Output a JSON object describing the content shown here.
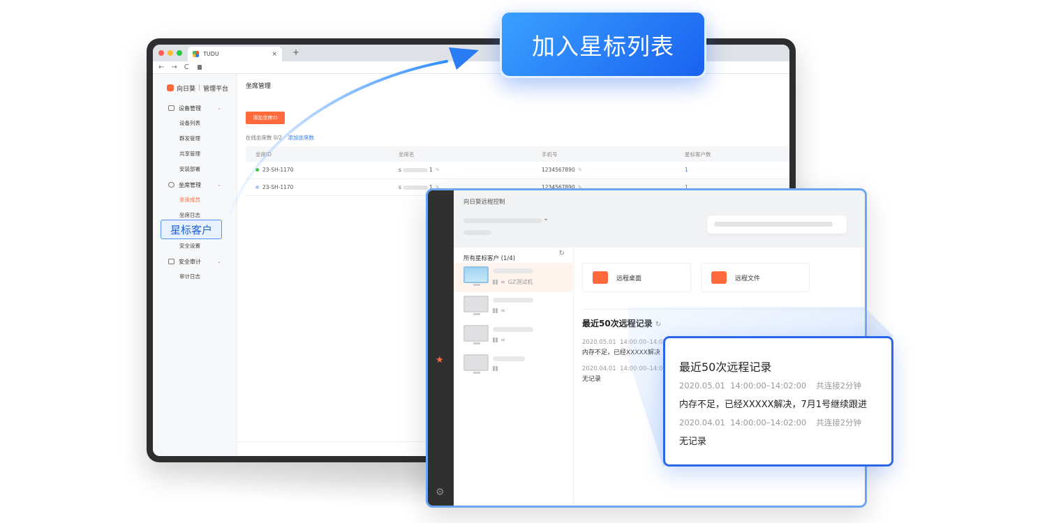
{
  "callouts": {
    "star_list": "加入星标列表",
    "star_client": "星标客户"
  },
  "browser": {
    "tab_title": "TUDU",
    "tab_close": "×",
    "new_tab": "+",
    "nav_back": "←",
    "nav_forward": "→",
    "nav_reload": "C"
  },
  "admin": {
    "brand": "向日葵",
    "brand_suffix": "管理平台",
    "nav": {
      "device_mgmt": "设备管理",
      "device_list": "设备列表",
      "batch_deploy": "群发管理",
      "share_mgmt": "共享管理",
      "install_deploy": "安装部署",
      "seat_mgmt": "坐席管理",
      "seat_members": "坐席成员",
      "seat_log": "坐席日志",
      "security_settings": "安全设置",
      "security_audit": "安全审计",
      "audit_log": "审计日志"
    },
    "page_title": "坐席管理",
    "add_seat_button": "添加坐席ID",
    "seat_count_label": "在线坐席数 0/2",
    "add_seat_link": "添加坐席数",
    "table": {
      "headers": [
        "坐席ID",
        "坐席名",
        "手机号",
        "星标客户数"
      ],
      "rows": [
        {
          "id": "23-SH-1170",
          "name_prefix": "s",
          "name_suffix": "1",
          "phone": "1234567890",
          "count": "1",
          "status_color": "#3fbf3f"
        },
        {
          "id": "23-SH-1170",
          "name_prefix": "s",
          "name_suffix": "1",
          "phone": "1234567890",
          "count": "1",
          "status_color": "#aac8ee"
        }
      ]
    }
  },
  "client": {
    "title": "向日葵远程控制",
    "list_header": "所有星标客户 (1/4)",
    "selected_device": "GZ测试机",
    "remote_desktop": "远程桌面",
    "remote_file": "远程文件",
    "records_title": "最近50次远程记录",
    "records": [
      {
        "date": "2020.05.01",
        "time": "14:00:00–14:02:00",
        "desc": "内存不足，已经XXXXX解决"
      },
      {
        "date": "2020.04.01",
        "time": "14:00:00–14:02:00",
        "desc": "无记录"
      }
    ]
  },
  "popup": {
    "title": "最近50次远程记录",
    "records": [
      {
        "date": "2020.05.01",
        "time": "14:00:00–14:02:00",
        "duration": "共连接2分钟",
        "desc": "内存不足，已经XXXXX解决，7月1号继续跟进"
      },
      {
        "date": "2020.04.01",
        "time": "14:00:00–14:02:00",
        "duration": "共连接2分钟",
        "desc": "无记录"
      }
    ]
  },
  "colors": {
    "accent_orange": "#ff6a3c",
    "accent_blue": "#1962f0",
    "link_blue": "#2b7cf2"
  },
  "icons": [
    "star-user-icon",
    "gear-icon",
    "refresh-icon",
    "windows-icon",
    "share-icon",
    "monitor-icon",
    "lock-icon",
    "edit-icon",
    "chevron-down-icon"
  ]
}
